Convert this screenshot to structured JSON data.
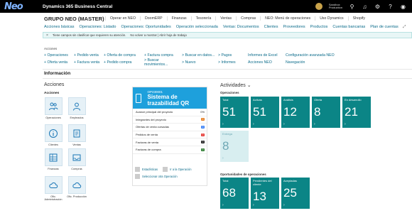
{
  "topbar": {
    "logo": "Neo",
    "app_name": "Dynamics 365 Business Central",
    "environment_line1": "Sandbox",
    "environment_line2": "Production"
  },
  "company": "GRUPO NEO (MASTER)",
  "menu": [
    "Operar en NEO",
    "DoomERP",
    "Finanzas",
    "Tesorería",
    "Ventas",
    "Compras",
    "NEO: Menú de operaciones",
    "Uso Dynamics",
    "Shopify"
  ],
  "subnav": [
    "Acciones básicas",
    "Operaciones: Listado",
    "Operaciones: Oportunidades",
    "Operación seleccionada",
    "Ventas: Documentos",
    "Clientes",
    "Proveedores",
    "Productos",
    "Cuentas bancarias",
    "Plan de cuentas"
  ],
  "notice": {
    "text": "Tiene campos sin clasificar que requieren su atención.",
    "dismiss": "No volver a mostrar | Abrir hoja de trabajo"
  },
  "actions": {
    "label": "Acciones",
    "row1": [
      "+ Operaciones",
      "+ Pedido venta",
      "+ Oferta de compra",
      "+ Factura compra",
      "> Buscar en datos...",
      "> Pagos",
      "Informes de Excel",
      "Configuración avanzada NEO"
    ],
    "row2": [
      "+ Oferta venta",
      "+ Factura venta",
      "+ Pedido compra",
      "> Buscar movimientos...",
      "> Nuevo",
      "> Informes",
      "Acciones NEO",
      "Navegación"
    ]
  },
  "section_title": "Información",
  "acciones_panel": {
    "heading": "Acciones",
    "subheading": "Acciones",
    "items": [
      {
        "label": "Operaciones",
        "icon": "people-icon"
      },
      {
        "label": "Empleados",
        "icon": "person-icon"
      },
      {
        "label": "Clientes",
        "icon": "info-icon"
      },
      {
        "label": "Ventas",
        "icon": "document-icon"
      },
      {
        "label": "Finanzas",
        "icon": "grid-icon"
      },
      {
        "label": "Compras",
        "icon": "inbox-icon"
      },
      {
        "label": "Ofic. Administración",
        "icon": "cloud-icon"
      },
      {
        "label": "Ofic. Producción",
        "icon": "cloud-icon"
      }
    ]
  },
  "project_card": {
    "code": "OP230001",
    "title": "Sistema de trazabilidad QR",
    "rows": [
      {
        "label": "Avance principal del proyecto",
        "value": "0%"
      },
      {
        "label": "Integrantes del proyecto",
        "value": "0",
        "color": "#e67e22"
      },
      {
        "label": "Ofertas de venta cursadas",
        "value": "0",
        "color": "#3b82f6"
      },
      {
        "label": "Pedidos de venta",
        "value": "0",
        "color": "#e53935"
      },
      {
        "label": "Facturas de venta",
        "value": "0",
        "color": "#212121"
      },
      {
        "label": "Facturas de compra",
        "value": "0",
        "color": "#2e7d32"
      }
    ],
    "buttons": [
      "Estadísticas",
      "Ir a la Operación",
      "Seleccionar otra Operación"
    ]
  },
  "activities": {
    "heading": "Actividades",
    "group1": "Operaciones",
    "tiles1": [
      {
        "label": "Total",
        "value": "51"
      },
      {
        "label": "Activas",
        "value": "51"
      },
      {
        "label": "Análisis",
        "value": "12"
      },
      {
        "label": "Oferta",
        "value": "8"
      },
      {
        "label": "En desarrollo",
        "value": "21"
      },
      {
        "label": "Entrega",
        "value": "8"
      }
    ],
    "group2": "Oportunidades de operaciones",
    "tiles2": [
      {
        "label": "Total",
        "value": "68"
      },
      {
        "label": "Pendientes del cliente",
        "value": "13"
      },
      {
        "label": "Aceptadas",
        "value": "25"
      }
    ]
  }
}
